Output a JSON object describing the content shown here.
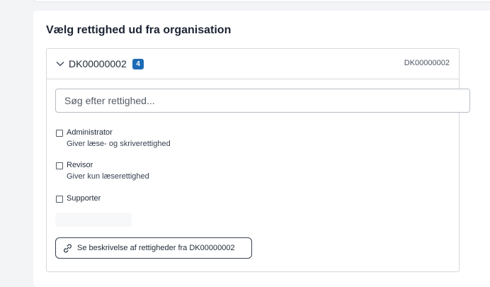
{
  "card": {
    "title": "Vælg rettighed ud fra organisation"
  },
  "organisation": {
    "name": "DK00000002",
    "count": "4",
    "id": "DK00000002",
    "expanded": true
  },
  "search": {
    "placeholder": "Søg efter rettighed...",
    "value": ""
  },
  "permissions": [
    {
      "label": "Administrator",
      "description": "Giver læse- og skriverettighed",
      "checked": false
    },
    {
      "label": "Revisor",
      "description": "Giver kun læserettighed",
      "checked": false
    },
    {
      "label": "Supporter",
      "description": "",
      "checked": false
    }
  ],
  "description_link": {
    "label": "Se beskrivelse af rettigheder fra DK00000002",
    "icon": "link-icon"
  },
  "colors": {
    "badge": "#1e6bb8",
    "border": "#d6d9de",
    "background": "#f3f4f6"
  }
}
